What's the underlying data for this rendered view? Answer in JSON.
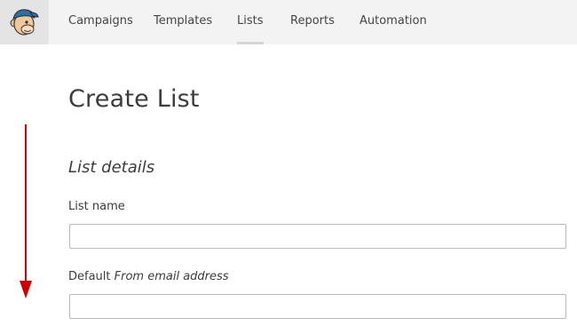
{
  "nav": {
    "logo": "mailchimp-freddie-logo",
    "items": [
      {
        "label": "Campaigns",
        "active": false
      },
      {
        "label": "Templates",
        "active": false
      },
      {
        "label": "Lists",
        "active": true
      },
      {
        "label": "Reports",
        "active": false
      },
      {
        "label": "Automation",
        "active": false
      }
    ]
  },
  "main": {
    "title": "Create List",
    "section_heading": "List details",
    "fields": [
      {
        "label": "List name",
        "value": "",
        "placeholder": ""
      },
      {
        "label_prefix": "Default ",
        "label_emphasis": "From email address",
        "value": "",
        "placeholder": ""
      }
    ]
  },
  "annotation": {
    "type": "scroll-down-arrow",
    "color": "#cc0000"
  },
  "colors": {
    "nav_background": "#f3f3f3",
    "logo_background": "#e4e4e4",
    "text": "#3c3c3c",
    "input_border": "#b8b8b8",
    "arrow": "#cc0000"
  }
}
